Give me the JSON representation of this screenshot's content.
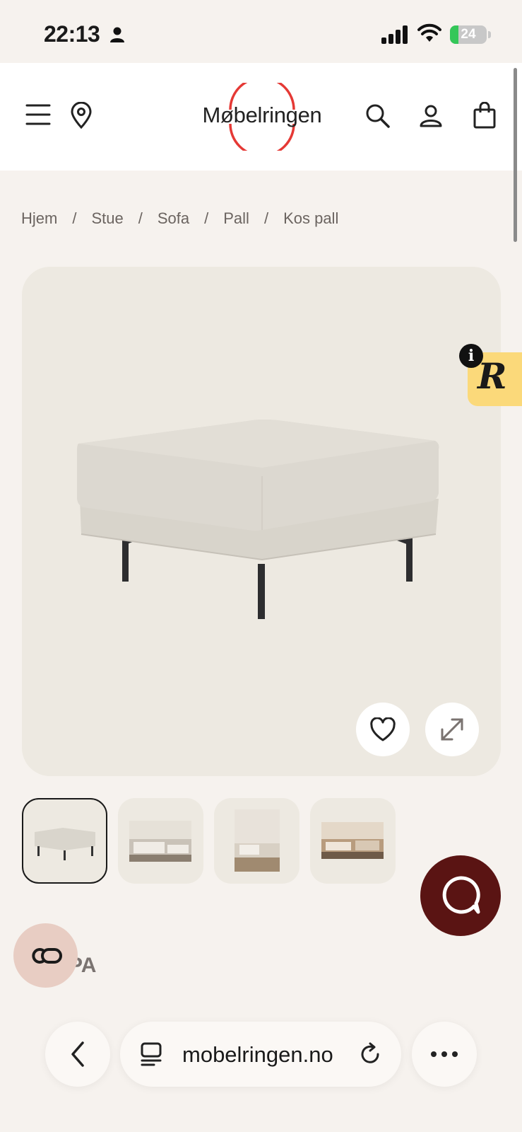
{
  "status_bar": {
    "time": "22:13",
    "battery": "24",
    "battery_level": 0.24
  },
  "header": {
    "logo_text": "Møbelringen",
    "brand_color": "#e53935"
  },
  "breadcrumb": [
    "Hjem",
    "Stue",
    "Sofa",
    "Pall",
    "Kos pall"
  ],
  "breadcrumb_separator": "/",
  "gallery": {
    "thumbnail_count": 4,
    "active_index": 0
  },
  "badge": {
    "letter": "R",
    "info": "i"
  },
  "section": {
    "partial_heading": "PA"
  },
  "browser": {
    "url": "mobelringen.no"
  },
  "icons": [
    "person-icon",
    "signal-icon",
    "wifi-icon",
    "menu-icon",
    "location-pin-icon",
    "search-icon",
    "account-icon",
    "cart-icon",
    "heart-icon",
    "expand-icon",
    "chat-icon",
    "co-icon",
    "chevron-left-icon",
    "tabs-icon",
    "reload-icon",
    "more-icon"
  ]
}
